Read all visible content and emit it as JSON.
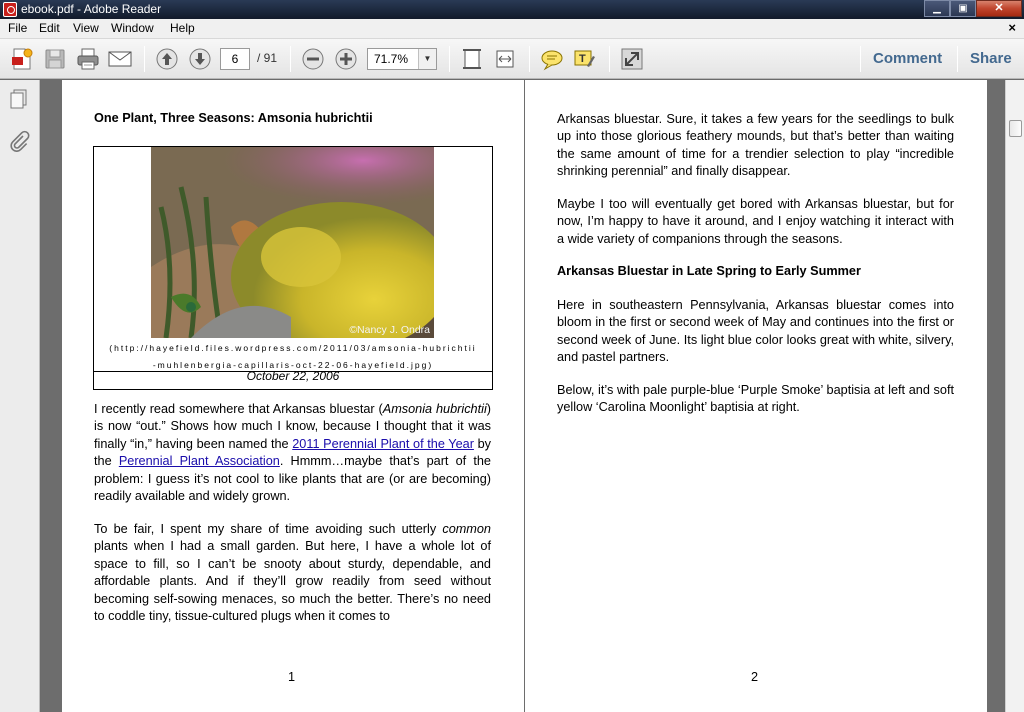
{
  "window": {
    "title": "ebook.pdf - Adobe Reader",
    "minimize": "▁",
    "maximize": "▣",
    "close": "✕"
  },
  "menu": {
    "file": "File",
    "edit": "Edit",
    "view": "View",
    "window": "Window",
    "help": "Help",
    "doc_close": "×"
  },
  "toolbar": {
    "page_current": "6",
    "page_total": "/ 91",
    "zoom": "71.7%",
    "comment": "Comment",
    "share": "Share"
  },
  "colors": {
    "accent": "#43698f",
    "link": "#1a0dab",
    "titlebar": "#1b273c"
  },
  "left_page": {
    "heading": "One Plant, Three Seasons: Amsonia hubrichtii",
    "photo_credit": "©Nancy J. Ondra",
    "fig_url_line1": "(http://hayefield.files.wordpress.com/2011/03/amsonia-hubrichtii",
    "fig_url_line2": "-muhlenbergia-capillaris-oct-22-06-hayefield.jpg)",
    "fig_date": "October 22, 2006",
    "p1_a": "I recently read somewhere that Arkansas bluestar (",
    "p1_italic": "Amsonia hubrichtii",
    "p1_b": ") is now “out.” Shows how much I know, because I thought that it was finally “in,” having been named the ",
    "p1_link1": "2011 Perennial Plant of the Year",
    "p1_c": " by the ",
    "p1_link2": "Perennial Plant Association",
    "p1_d": ". Hmmm…maybe that’s part of the problem: I guess it’s not cool to like plants that are (or are becoming) readily available and widely grown.",
    "p2_a": "To be fair, I spent my share of time avoiding such utterly ",
    "p2_italic": "common",
    "p2_b": " plants when I had a small garden. But here, I have a whole lot of space to fill, so I can’t be snooty about sturdy, dependable, and affordable plants. And if they’ll grow readily from seed without becoming self-sowing menaces, so much the better. There’s no need to coddle tiny, tissue-cultured plugs when it comes to",
    "page_number": "1"
  },
  "right_page": {
    "p1": "Arkansas bluestar. Sure, it takes a few years for the seedlings to bulk up into those glorious feathery mounds, but that’s better than waiting the same amount of time for a trendier selection to play “incredible shrinking perennial” and finally disappear.",
    "p2": "Maybe I too will eventually get bored with Arkansas bluestar, but for now, I’m happy to have it around, and I enjoy watching it interact with a wide variety of companions through the seasons.",
    "heading": "Arkansas Bluestar in Late Spring to Early Summer",
    "p3": "Here in southeastern Pennsylvania, Arkansas bluestar comes into bloom in the first or second week of May and continues into the first or second week of June. Its light blue color looks great with white, silvery, and pastel partners.",
    "p4": "Below, it’s with pale purple-blue ‘Purple Smoke’ baptisia at left and soft yellow ‘Carolina Moonlight’ baptisia at right.",
    "page_number": "2"
  }
}
